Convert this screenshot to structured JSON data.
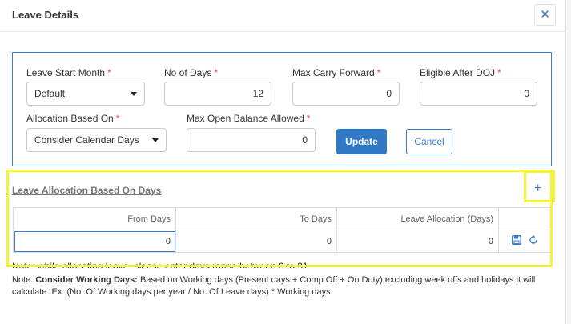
{
  "header": {
    "title": "Leave Details",
    "close_icon": "close-icon"
  },
  "form": {
    "leave_start_month": {
      "label": "Leave Start Month",
      "required": "*",
      "value": "Default"
    },
    "no_of_days": {
      "label": "No of Days",
      "required": "*",
      "value": "12"
    },
    "max_carry_forward": {
      "label": "Max Carry Forward",
      "required": "*",
      "value": "0"
    },
    "eligible_after_doj": {
      "label": "Eligible After DOJ",
      "required": "*",
      "value": "0"
    },
    "allocation_based_on": {
      "label": "Allocation Based On",
      "required": "*",
      "value": "Consider Calendar Days"
    },
    "max_open_balance": {
      "label": "Max Open Balance Allowed",
      "required": "*",
      "value": "0"
    },
    "update_label": "Update",
    "cancel_label": "Cancel"
  },
  "allocation": {
    "title": "Leave Allocation Based On Days",
    "add_icon": "plus-icon",
    "add_label": "+",
    "columns": [
      "From Days",
      "To Days",
      "Leave Allocation (Days)",
      ""
    ],
    "rows": [
      {
        "from_days": "0",
        "to_days": "0",
        "leave_allocation": "0"
      }
    ],
    "row_actions": [
      "save-icon",
      "refresh-icon"
    ]
  },
  "notes": {
    "partial_text": "Note: while allocating leave, please enter days range between 0 to 31",
    "label": "Note:",
    "bold_term": "Consider Working Days:",
    "body": "Based on Working days (Present days + Comp Off + On Duty) excluding week offs and holidays it will calculate. Ex. (No. Of Working days per year / No. Of Leave days) * Working days."
  },
  "colors": {
    "accent": "#3a7bd5",
    "primary_button": "#3179c4",
    "highlight": "#f3f33b",
    "required": "#d9534f"
  }
}
